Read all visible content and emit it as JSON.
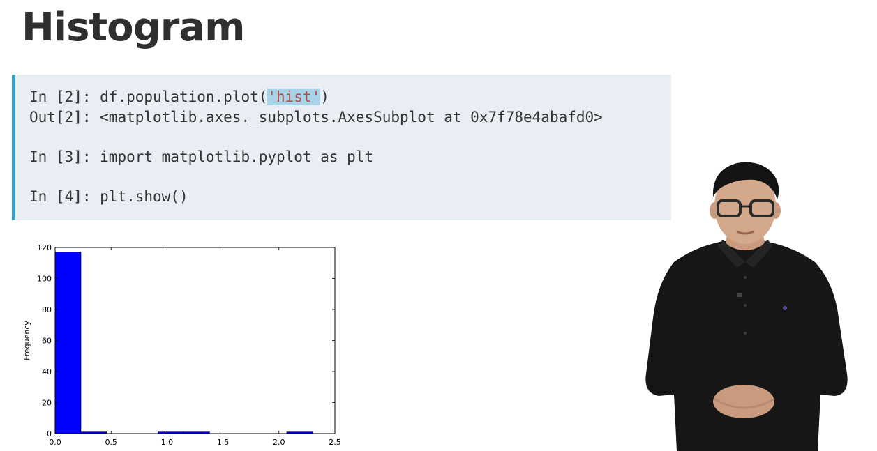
{
  "slide": {
    "title": "Histogram"
  },
  "code": {
    "lines": [
      {
        "prompt": "In [2]: ",
        "code_before": "df.population.plot(",
        "string_token": "'hist'",
        "code_after": ")"
      },
      {
        "prompt": "Out[2]: ",
        "text": "<matplotlib.axes._subplots.AxesSubplot at 0x7f78e4abafd0>"
      },
      {
        "prompt": "In [3]: ",
        "text": "import matplotlib.pyplot as plt"
      },
      {
        "prompt": "In [4]: ",
        "text": "plt.show()"
      }
    ]
  },
  "colors": {
    "code_bg": "#e8eef3",
    "code_accent": "#38a3c7",
    "bar_fill": "#0000ff",
    "title_text": "#2f2f2f"
  },
  "chart_data": {
    "type": "bar",
    "ylabel": "Frequency",
    "xlim": [
      0.0,
      2.5
    ],
    "ylim": [
      0,
      120
    ],
    "x_ticks": [
      "0.0",
      "0.5",
      "1.0",
      "1.5",
      "2.0",
      "2.5"
    ],
    "y_ticks": [
      "0",
      "20",
      "40",
      "60",
      "80",
      "100",
      "120"
    ],
    "bins": [
      {
        "x0": 0.0,
        "x1": 0.23,
        "count": 117
      },
      {
        "x0": 0.23,
        "x1": 0.46,
        "count": 1
      },
      {
        "x0": 0.46,
        "x1": 0.69,
        "count": 0
      },
      {
        "x0": 0.69,
        "x1": 0.92,
        "count": 0
      },
      {
        "x0": 0.92,
        "x1": 1.15,
        "count": 1
      },
      {
        "x0": 1.15,
        "x1": 1.38,
        "count": 1
      },
      {
        "x0": 1.38,
        "x1": 1.61,
        "count": 0
      },
      {
        "x0": 1.61,
        "x1": 1.84,
        "count": 0
      },
      {
        "x0": 1.84,
        "x1": 2.07,
        "count": 0
      },
      {
        "x0": 2.07,
        "x1": 2.3,
        "count": 1
      }
    ],
    "grid": false
  }
}
